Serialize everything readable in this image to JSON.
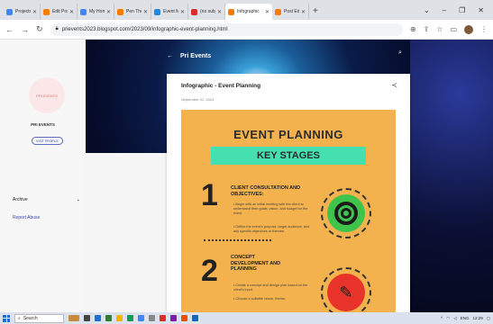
{
  "browser": {
    "tabs": [
      {
        "title": "Projects - Co",
        "color": "#4285f4"
      },
      {
        "title": "Edit Post - P",
        "color": "#f57c00"
      },
      {
        "title": "My Home - W",
        "color": "#4285f4"
      },
      {
        "title": "Pen Theme",
        "color": "#f57c00"
      },
      {
        "title": "Event Manag",
        "color": "#1e88e5"
      },
      {
        "title": "(no subject)",
        "color": "#d93025"
      },
      {
        "title": "Infographic",
        "color": "#f57c00",
        "active": true
      },
      {
        "title": "Post Edit",
        "color": "#f57c00"
      }
    ],
    "new_tab": "+",
    "url": "prievents2023.blogspot.com/2023/09/infographic-event-planning.html"
  },
  "sidebar": {
    "brand": "PRI EVENTS",
    "logo_text": "PRI EVENTS",
    "visit_label": "VISIT PROFILE",
    "archive_label": "Archive",
    "report_label": "Report Abuse"
  },
  "header": {
    "blog_title": "Pri Events"
  },
  "post": {
    "title": "Infographic - Event Planning",
    "date": "September 01, 2023",
    "infographic": {
      "heading": "EVENT PLANNING",
      "subheading": "KEY STAGES",
      "steps": [
        {
          "number": "1",
          "title": "CLIENT CONSULTATION AND OBJECTIVES:",
          "bullets": [
            "Begin with an initial meeting with the client to understand their goals, vision, and budget for the event.",
            "Define the event's purpose, target audience, and any specific objectives or themes."
          ]
        },
        {
          "number": "2",
          "title": "CONCEPT DEVELOPMENT AND PLANNING",
          "bullets": [
            "Create a concept and design plan based on the client's input.",
            "Choose a suitable venue, theme,"
          ]
        }
      ]
    }
  },
  "taskbar": {
    "search_placeholder": "Search",
    "tray_lang": "ENG",
    "tray_time": "12:29"
  }
}
